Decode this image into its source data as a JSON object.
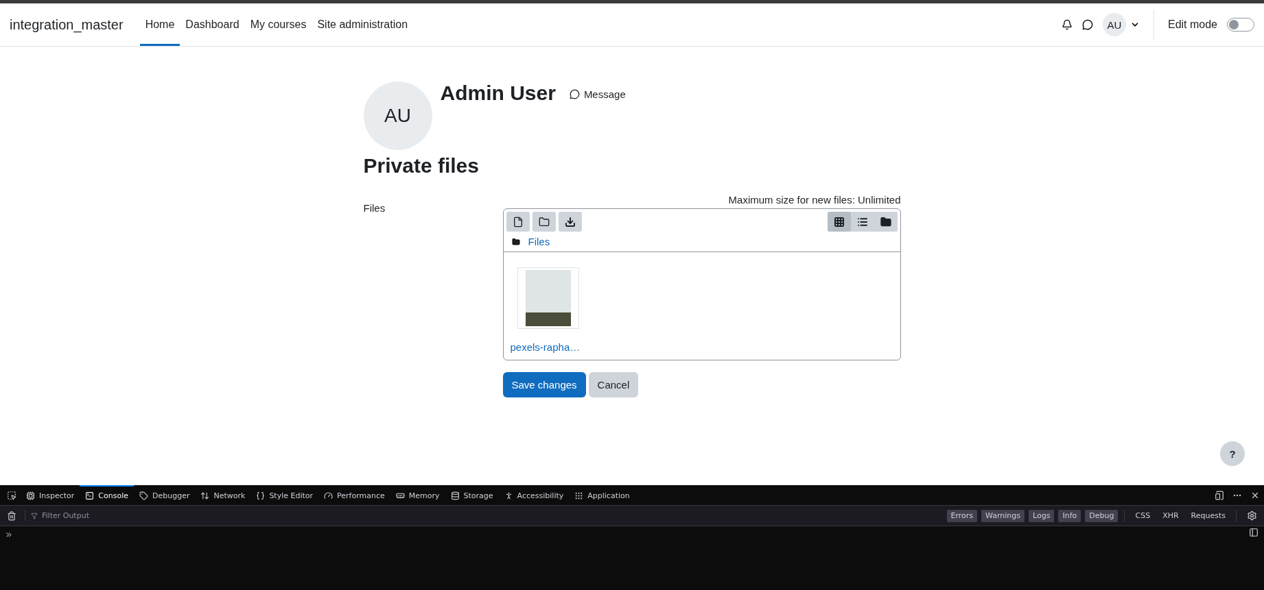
{
  "navbar": {
    "site_name": "integration_master",
    "items": [
      {
        "label": "Home",
        "selected": true
      },
      {
        "label": "Dashboard",
        "selected": false
      },
      {
        "label": "My courses",
        "selected": false
      },
      {
        "label": "Site administration",
        "selected": false
      }
    ],
    "user_initials": "AU",
    "edit_mode": {
      "label": "Edit mode",
      "on": false
    }
  },
  "profile": {
    "initials": "AU",
    "name": "Admin User",
    "message_link": "Message"
  },
  "heading": "Private files",
  "form": {
    "label": "Files",
    "max_size": "Maximum size for new files: Unlimited",
    "view_buttons": [
      {
        "kind": "grid",
        "selected": true
      },
      {
        "kind": "list",
        "selected": false
      },
      {
        "kind": "tree",
        "selected": false
      }
    ],
    "breadcrumb": "Files",
    "files": [
      {
        "name": "pexels-rapha…"
      }
    ],
    "buttons": [
      {
        "label": "Save changes",
        "kind": "primary"
      },
      {
        "label": "Cancel",
        "kind": "secondary"
      }
    ]
  },
  "help_button": "?",
  "devtools": {
    "tabs": [
      {
        "label": "Inspector",
        "selected": false
      },
      {
        "label": "Console",
        "selected": true
      },
      {
        "label": "Debugger",
        "selected": false
      },
      {
        "label": "Network",
        "selected": false
      },
      {
        "label": "Style Editor",
        "selected": false
      },
      {
        "label": "Performance",
        "selected": false
      },
      {
        "label": "Memory",
        "selected": false
      },
      {
        "label": "Storage",
        "selected": false
      },
      {
        "label": "Accessibility",
        "selected": false
      },
      {
        "label": "Application",
        "selected": false
      }
    ],
    "filter_placeholder": "Filter Output",
    "levels": [
      {
        "label": "Errors",
        "selected": true
      },
      {
        "label": "Warnings",
        "selected": true
      },
      {
        "label": "Logs",
        "selected": true
      },
      {
        "label": "Info",
        "selected": true
      },
      {
        "label": "Debug",
        "selected": true
      }
    ],
    "types": [
      {
        "label": "CSS",
        "selected": false
      },
      {
        "label": "XHR",
        "selected": false
      },
      {
        "label": "Requests",
        "selected": false
      }
    ],
    "prompt": "»"
  }
}
